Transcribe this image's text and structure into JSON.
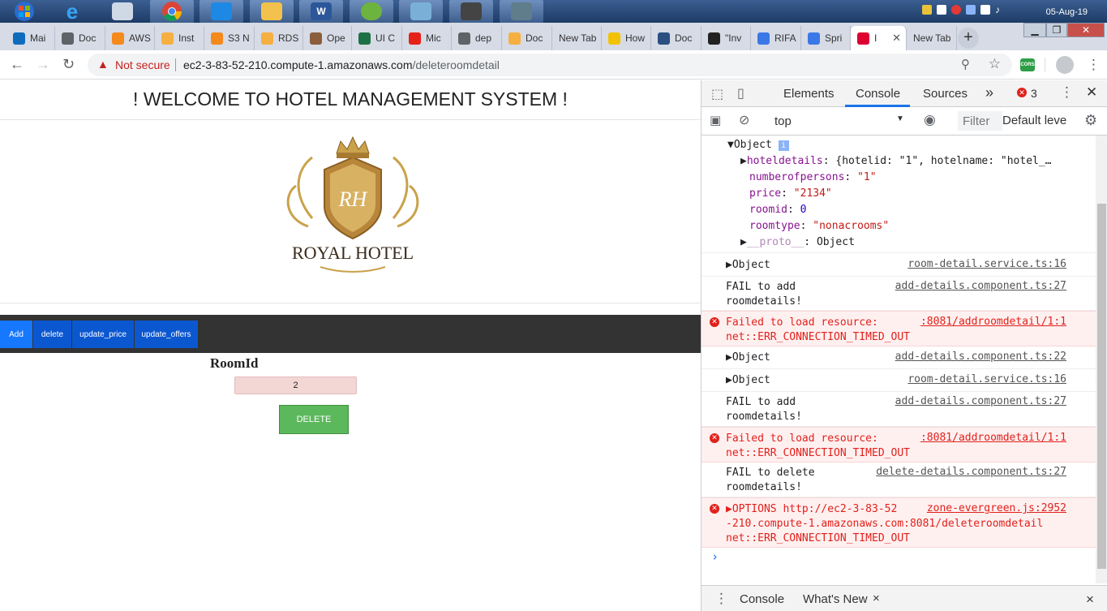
{
  "taskbar": {
    "apps": [
      "windows-start",
      "internet-explorer",
      "snipping-tool",
      "chrome",
      "visual-studio-code",
      "file-explorer",
      "word",
      "spring-tool-suite",
      "photos",
      "network-tool",
      "remote-desktop"
    ],
    "date": "05-Aug-19"
  },
  "browser": {
    "tabs": [
      {
        "label": "Mai",
        "icon": "outlook-icon",
        "color": "#0f6cbd"
      },
      {
        "label": "Doc",
        "icon": "globe-icon",
        "color": "#5f6368"
      },
      {
        "label": "AWS",
        "icon": "aws-box-icon",
        "color": "#f48a1c"
      },
      {
        "label": "Inst",
        "icon": "aws-box-icon",
        "color": "#f5b041"
      },
      {
        "label": "S3 N",
        "icon": "aws-box-icon",
        "color": "#f48a1c"
      },
      {
        "label": "RDS",
        "icon": "aws-box-icon",
        "color": "#f5b041"
      },
      {
        "label": "Ope",
        "icon": "document-icon",
        "color": "#8b5e3c"
      },
      {
        "label": "UI C",
        "icon": "excel-icon",
        "color": "#1e7145"
      },
      {
        "label": "Mic",
        "icon": "youtube-icon",
        "color": "#e62117"
      },
      {
        "label": "dep",
        "icon": "globe-icon",
        "color": "#5f6368"
      },
      {
        "label": "Doc",
        "icon": "aws-box-icon",
        "color": "#f5b041"
      },
      {
        "label": "New Tab",
        "icon": "",
        "color": ""
      },
      {
        "label": "How",
        "icon": "lightbulb-icon",
        "color": "#f2c200"
      },
      {
        "label": "Doc",
        "icon": "globe-icon",
        "color": "#2b4f81"
      },
      {
        "label": "\"Inv",
        "icon": "github-icon",
        "color": "#222222"
      },
      {
        "label": "RIFA",
        "icon": "stack-icon",
        "color": "#3b78e7"
      },
      {
        "label": "Spri",
        "icon": "spring-icon",
        "color": "#3b78e7"
      },
      {
        "label": "I",
        "icon": "angular-icon",
        "color": "#dd0031",
        "active": true
      },
      {
        "label": "New Tab",
        "icon": "",
        "color": ""
      }
    ],
    "new_tab": "+"
  },
  "toolbar": {
    "security": "Not secure",
    "url_host": "ec2-3-83-52-210.compute-1.amazonaws.com",
    "url_path": "/deleteroomdetail",
    "extension": "CORS"
  },
  "page": {
    "title": "! WELCOME TO HOTEL MANAGEMENT SYSTEM !",
    "logo_monogram": "RH",
    "logo_text": "ROYAL HOTEL",
    "nav": [
      "Add",
      "delete",
      "update_price",
      "update_offers"
    ],
    "form_label": "RoomId",
    "room_id_value": "2",
    "delete_button": "DELETE"
  },
  "devtools": {
    "tabs": [
      "Elements",
      "Console",
      "Sources"
    ],
    "active_tab": "Console",
    "more": "»",
    "error_count": "3",
    "context": "top",
    "filter_placeholder": "Filter",
    "levels": "Default leve",
    "object_tree": {
      "header": "Object",
      "hoteldetails_key": "hoteldetails",
      "hoteldetails_val": "{hotelid: \"1\", hotelname: \"hotel_…",
      "numberofpersons_key": "numberofpersons",
      "numberofpersons_val": "\"1\"",
      "price_key": "price",
      "price_val": "\"2134\"",
      "roomid_key": "roomid",
      "roomid_val": "0",
      "roomtype_key": "roomtype",
      "roomtype_val": "\"nonacrooms\"",
      "proto_key": "__proto__",
      "proto_val": "Object"
    },
    "messages": [
      {
        "text": "▶Object",
        "source": "room-detail.service.ts:16",
        "error": false
      },
      {
        "text": "FAIL to add\nroomdetails!",
        "source": "add-details.component.ts:27",
        "error": false
      },
      {
        "text": "Failed to load resource:\nnet::ERR_CONNECTION_TIMED_OUT",
        "source": ":8081/addroomdetail/1:1",
        "error": true
      },
      {
        "text": "▶Object",
        "source": "add-details.component.ts:22",
        "error": false
      },
      {
        "text": "▶Object",
        "source": "room-detail.service.ts:16",
        "error": false
      },
      {
        "text": "FAIL to add\nroomdetails!",
        "source": "add-details.component.ts:27",
        "error": false
      },
      {
        "text": "Failed to load resource:\nnet::ERR_CONNECTION_TIMED_OUT",
        "source": ":8081/addroomdetail/1:1",
        "error": true
      },
      {
        "text": "FAIL to delete\nroomdetails!",
        "source": "delete-details.component.ts:27",
        "error": false
      },
      {
        "text": "▶OPTIONS http://ec2-3-83-52\n-210.compute-1.amazonaws.com:8081/deleteroomdetail\nnet::ERR_CONNECTION_TIMED_OUT",
        "source": "zone-evergreen.js:2952",
        "error": true
      }
    ],
    "prompt": "›",
    "drawer_tabs": [
      "Console",
      "What's New"
    ],
    "drawer_close": "×"
  },
  "colors": {
    "accent": "#1a73e8",
    "error": "#e1211b",
    "delete_button": "#5cb85c",
    "nav_bar": "#333333"
  }
}
